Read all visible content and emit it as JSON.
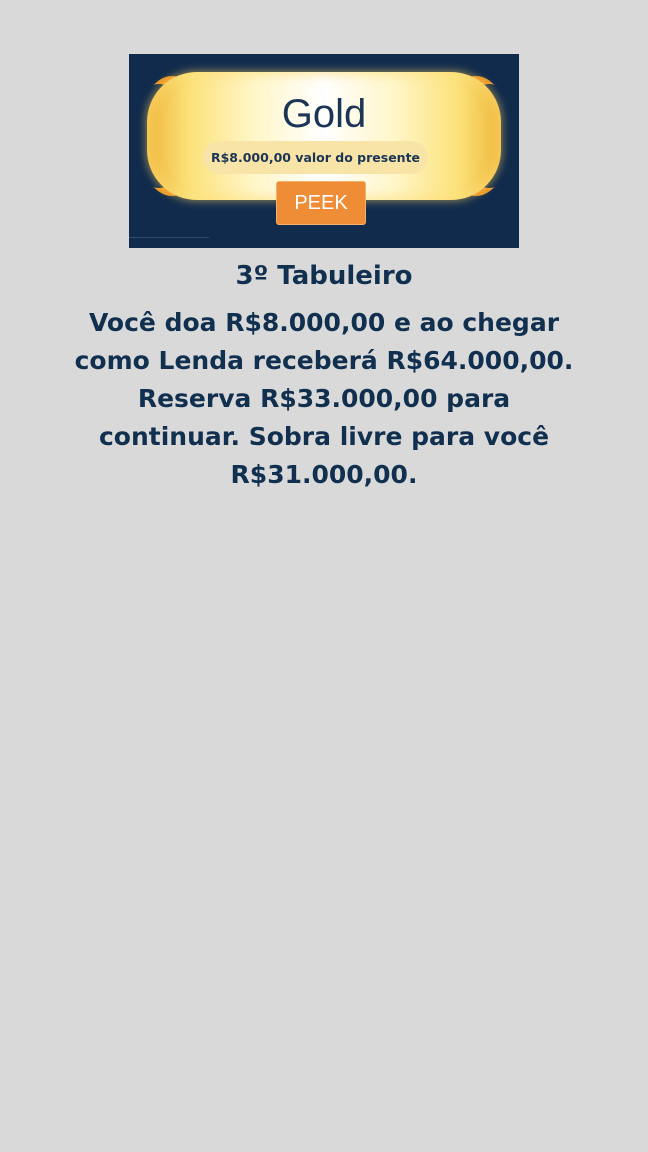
{
  "banner": {
    "title": "Gold",
    "value_label": "R$8.000,00 valor do presente",
    "button_label": "PEEK"
  },
  "content": {
    "heading": "3º Tabuleiro",
    "body": "Você doa R$8.000,00 e ao chegar como Lenda receberá R$64.000,00. Reserva R$33.000,00 para continuar. Sobra livre para você R$31.000,00."
  },
  "colors": {
    "page_background": "#d9d9d9",
    "banner_background": "#112b4d",
    "text_primary": "#11304f",
    "button_orange": "#ee8d35",
    "gold": "#f0b73a"
  }
}
